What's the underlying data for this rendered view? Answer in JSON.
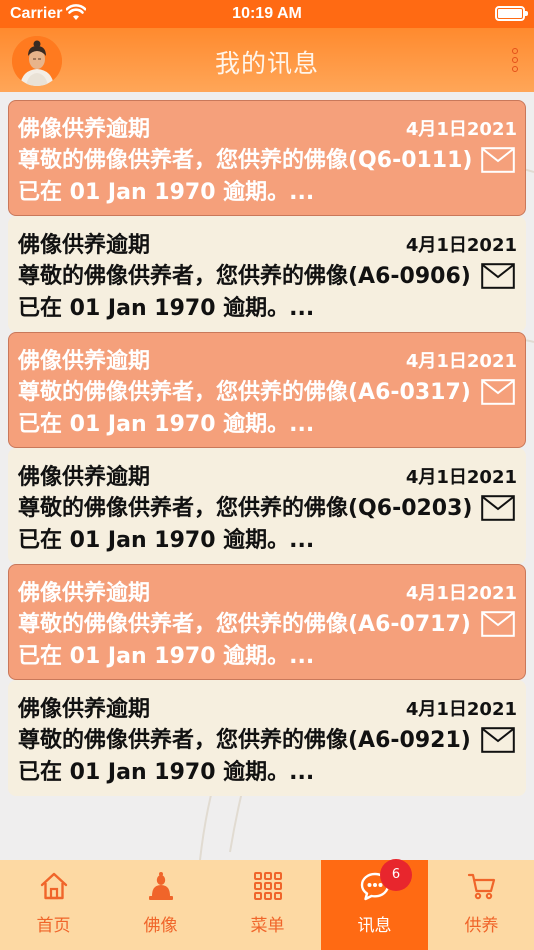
{
  "status_bar": {
    "carrier": "Carrier",
    "time": "10:19 AM"
  },
  "header": {
    "title": "我的讯息",
    "avatar_icon": "buddha-avatar-icon",
    "menu_icon": "more-vertical-icon"
  },
  "colors": {
    "primary": "#ff6a13",
    "highlight_card": "#f5a07b",
    "normal_card": "#f6efdf",
    "tab_bg": "#fdd9a3",
    "badge": "#e8262d"
  },
  "messages": [
    {
      "title": "佛像供养逾期",
      "date": "4月1日2021",
      "body": "尊敬的佛像供养者，您供养的佛像(Q6-0111) 已在 01 Jan 1970 逾期。...",
      "highlight": true
    },
    {
      "title": "佛像供养逾期",
      "date": "4月1日2021",
      "body": "尊敬的佛像供养者，您供养的佛像(A6-0906) 已在 01 Jan 1970 逾期。...",
      "highlight": false
    },
    {
      "title": "佛像供养逾期",
      "date": "4月1日2021",
      "body": "尊敬的佛像供养者，您供养的佛像(A6-0317) 已在 01 Jan 1970 逾期。...",
      "highlight": true
    },
    {
      "title": "佛像供养逾期",
      "date": "4月1日2021",
      "body": "尊敬的佛像供养者，您供养的佛像(Q6-0203) 已在 01 Jan 1970 逾期。...",
      "highlight": false
    },
    {
      "title": "佛像供养逾期",
      "date": "4月1日2021",
      "body": "尊敬的佛像供养者，您供养的佛像(A6-0717) 已在 01 Jan 1970 逾期。...",
      "highlight": true
    },
    {
      "title": "佛像供养逾期",
      "date": "4月1日2021",
      "body": "尊敬的佛像供养者，您供养的佛像(A6-0921) 已在 01 Jan 1970 逾期。...",
      "highlight": false
    }
  ],
  "tabs": [
    {
      "label": "首页",
      "icon": "home-icon",
      "active": false
    },
    {
      "label": "佛像",
      "icon": "buddha-statue-icon",
      "active": false
    },
    {
      "label": "菜单",
      "icon": "grid-menu-icon",
      "active": false
    },
    {
      "label": "讯息",
      "icon": "chat-bubble-icon",
      "active": true,
      "badge": "6"
    },
    {
      "label": "供养",
      "icon": "cart-icon",
      "active": false
    }
  ]
}
